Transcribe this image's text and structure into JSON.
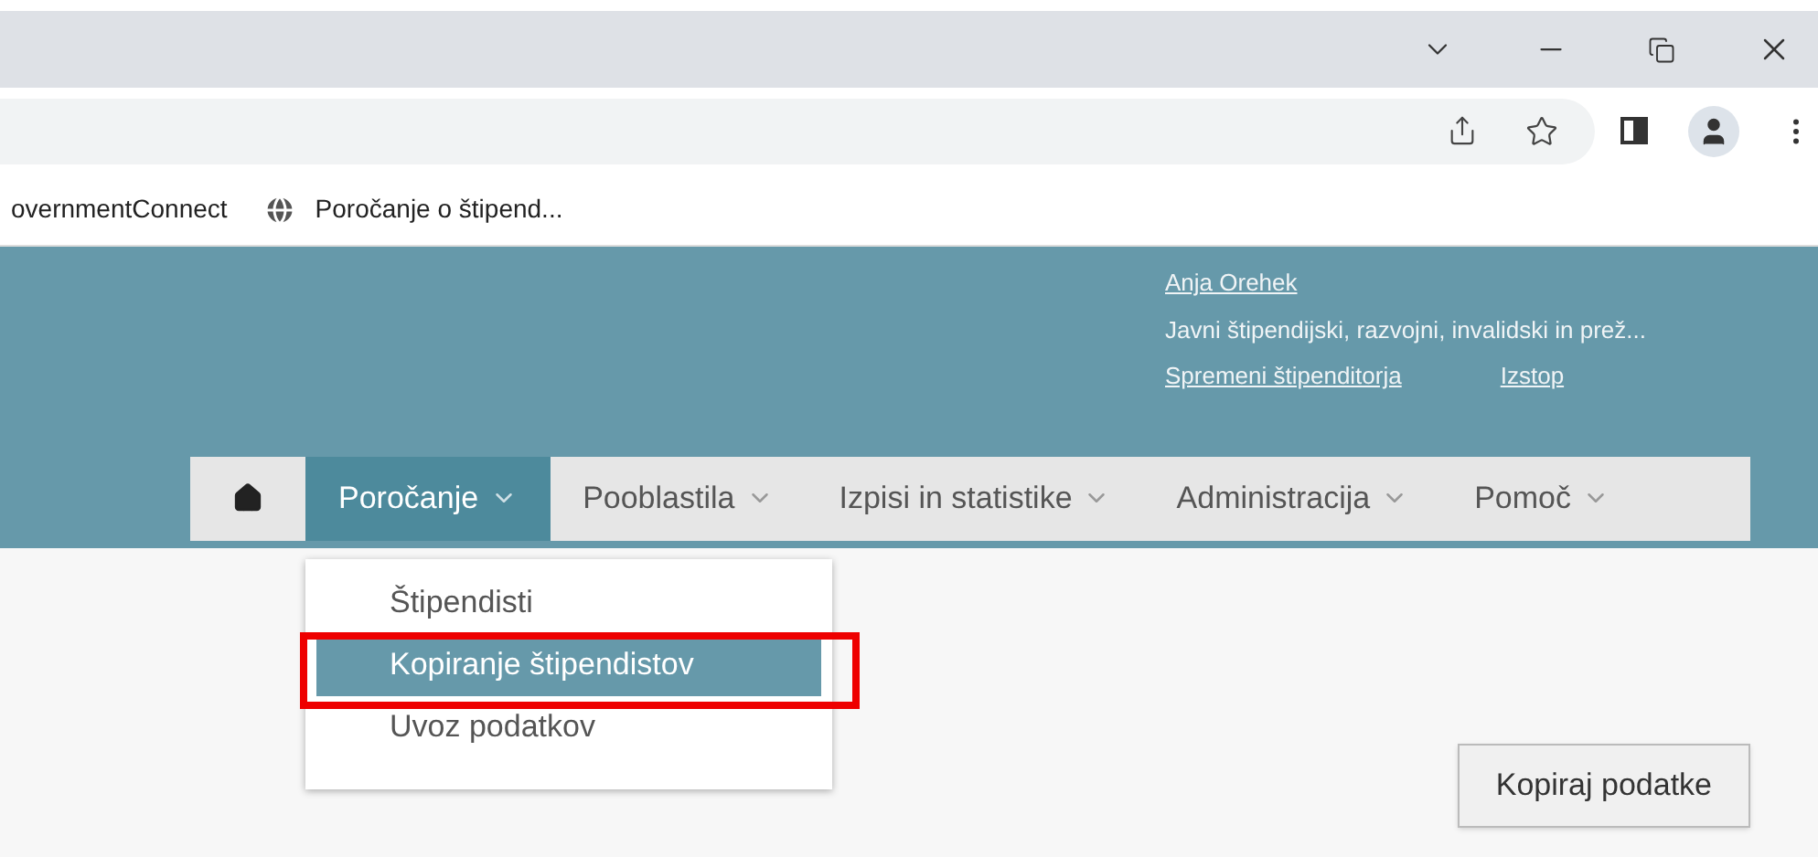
{
  "bookmarks": [
    {
      "label": "overnmentConnect",
      "kind": "text"
    },
    {
      "label": "Poročanje o štipend...",
      "kind": "globe"
    }
  ],
  "user": {
    "name": "Anja Orehek",
    "organization": "Javni štipendijski, razvojni, invalidski in prež...",
    "links": [
      "Spremeni štipenditorja",
      "Izstop"
    ]
  },
  "nav": [
    {
      "label": "Poročanje",
      "selected": true
    },
    {
      "label": "Pooblastila",
      "selected": false
    },
    {
      "label": "Izpisi in statistike",
      "selected": false
    },
    {
      "label": "Administracija",
      "selected": false
    },
    {
      "label": "Pomoč",
      "selected": false
    }
  ],
  "dropdown": [
    {
      "label": "Štipendisti",
      "selected": false
    },
    {
      "label": "Kopiranje štipendistov",
      "selected": true
    },
    {
      "label": "Uvoz podatkov",
      "selected": false
    }
  ],
  "action_button": "Kopiraj podatke"
}
